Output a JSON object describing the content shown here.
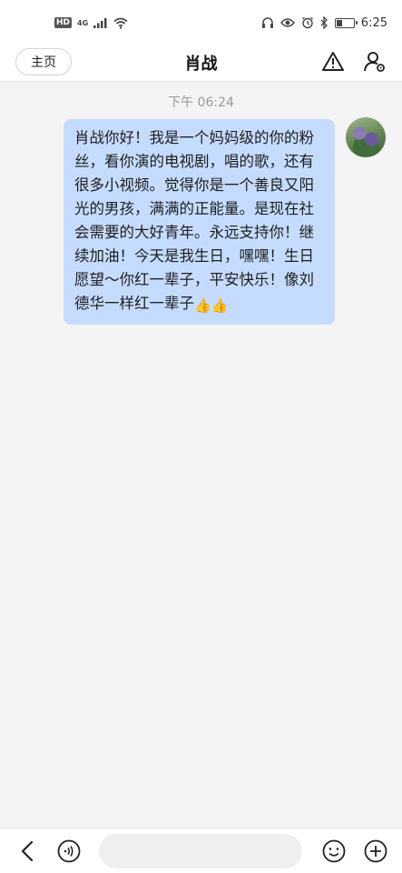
{
  "status_bar": {
    "hd": "HD",
    "network": "4G",
    "time": "6:25",
    "battery_level": 0.3,
    "icons": [
      "hd-icon",
      "signal-icon",
      "wifi-icon",
      "headset-icon",
      "eye-icon",
      "alarm-icon",
      "bluetooth-icon",
      "battery-icon"
    ]
  },
  "nav": {
    "home_label": "主页",
    "title": "肖战",
    "right_icons": [
      "warning-icon",
      "profile-settings-icon"
    ]
  },
  "chat": {
    "timestamp": "下午 06:24",
    "messages": [
      {
        "sender": "self",
        "text": "肖战你好！我是一个妈妈级的你的粉丝，看你演的电视剧，唱的歌，还有很多小视频。觉得你是一个善良又阳光的男孩，满满的正能量。是现在社会需要的大好青年。永远支持你！继续加油！今天是我生日，嘿嘿！生日愿望～你红一辈子，平安快乐！像刘德华一样红一辈子",
        "emoji": "👍👍"
      }
    ],
    "colors": {
      "bubble": "#c6dcfe",
      "background": "#f4f4f4"
    }
  },
  "bottom_bar": {
    "input_value": "",
    "icons": [
      "back-icon",
      "voice-icon",
      "emoji-icon",
      "plus-icon"
    ]
  }
}
